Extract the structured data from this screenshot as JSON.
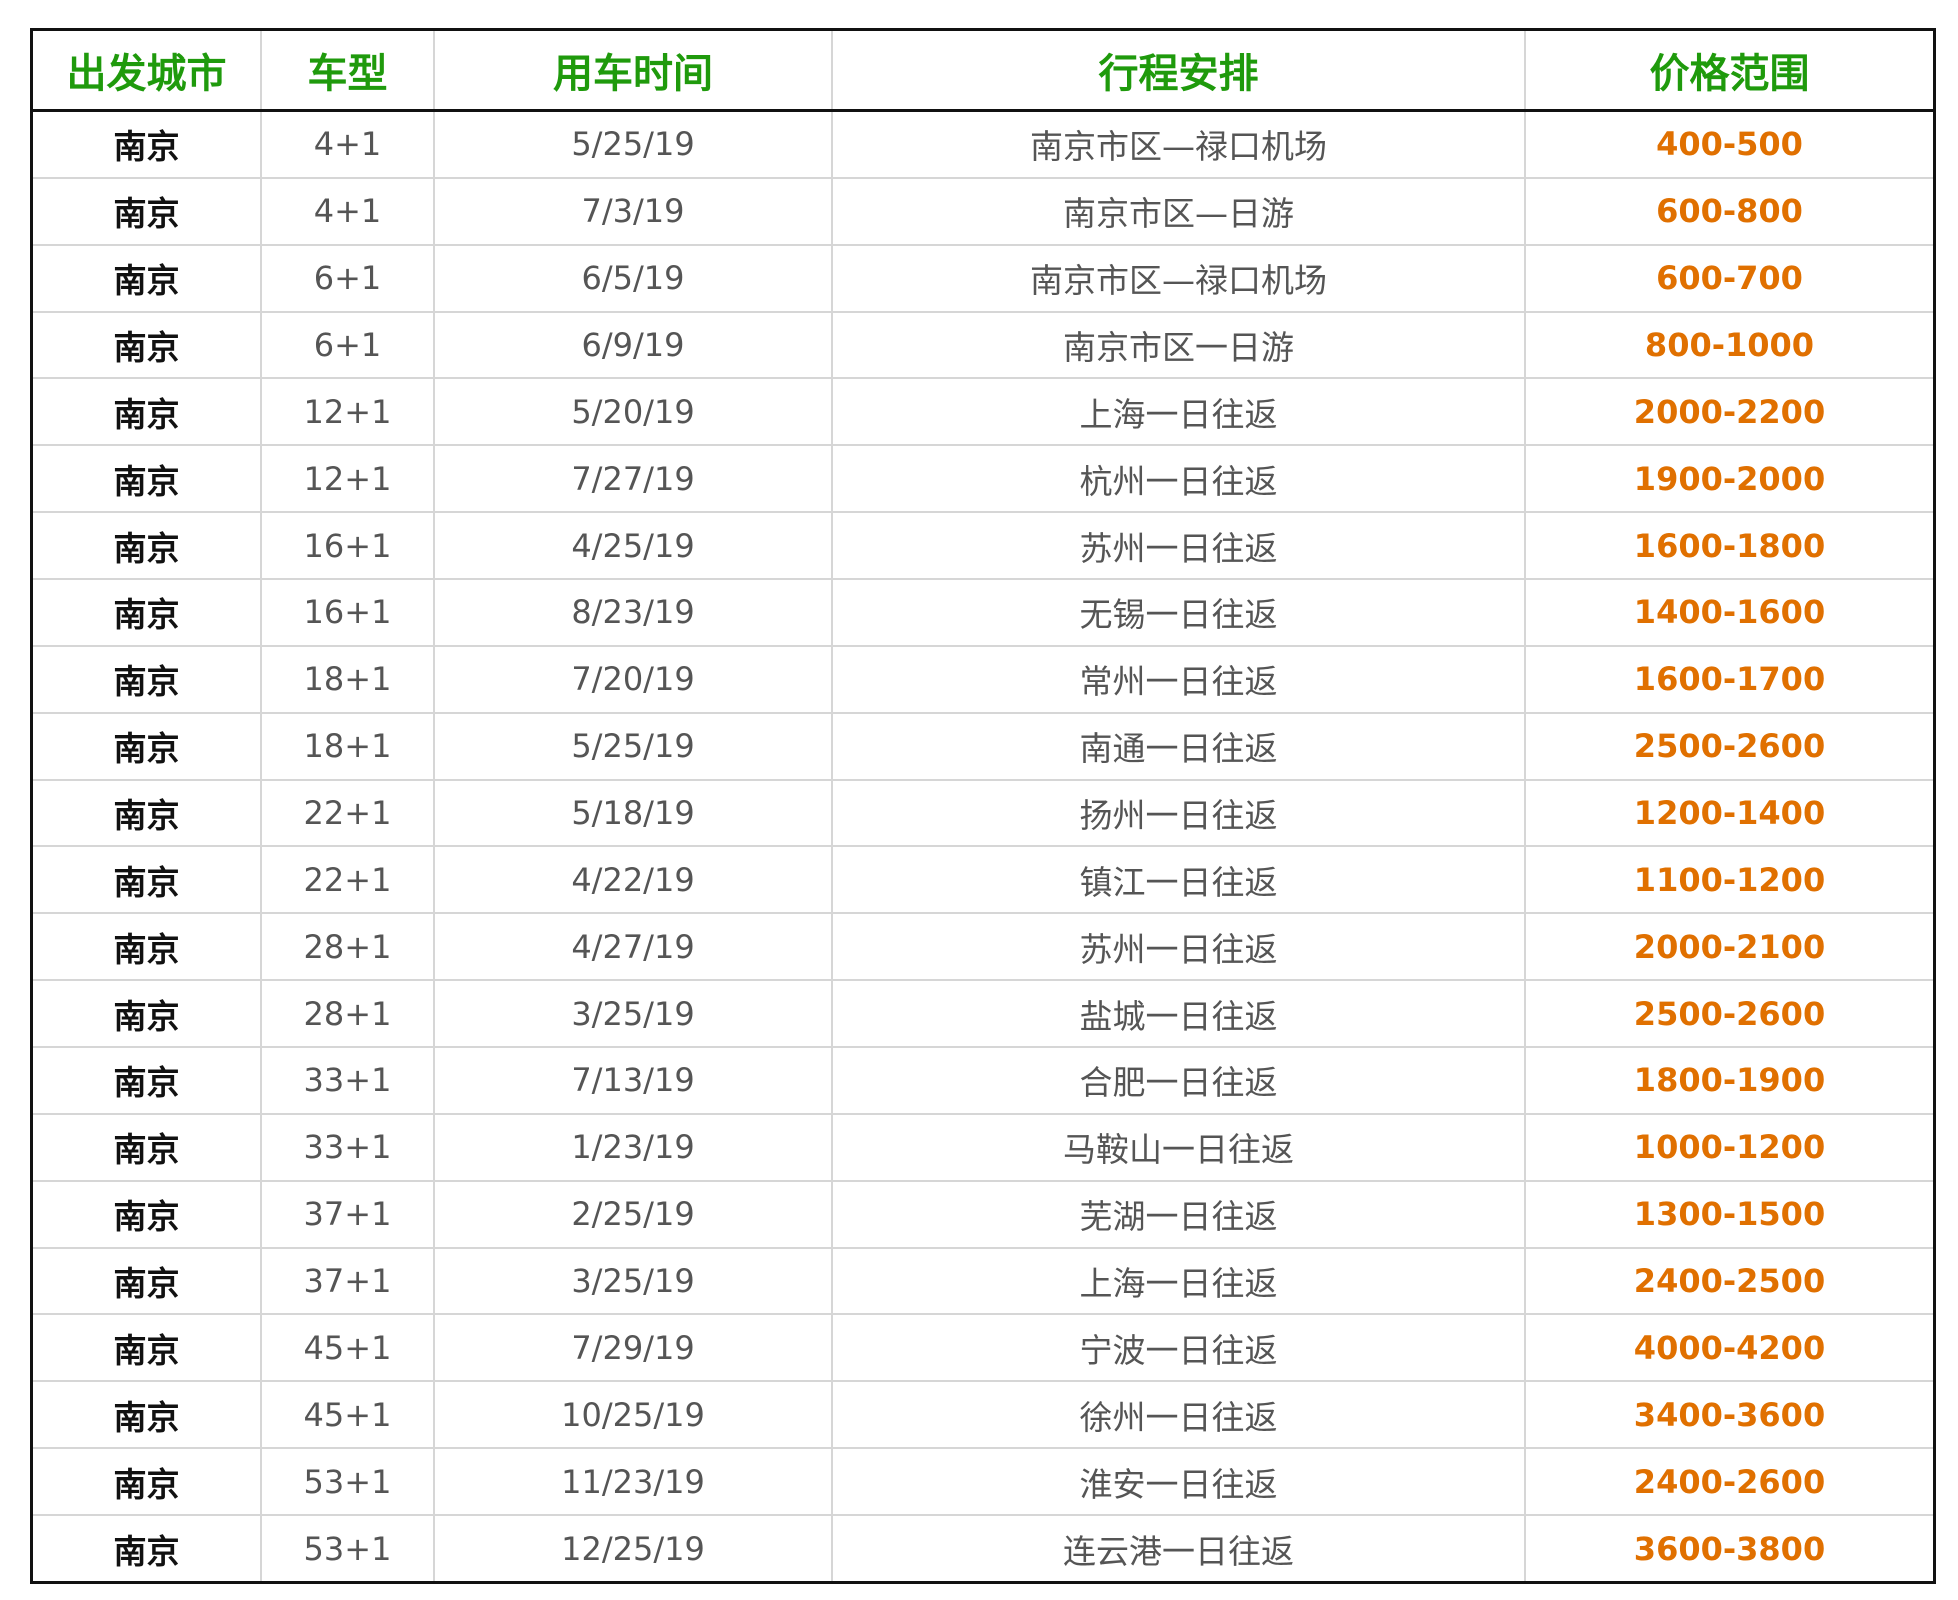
{
  "colors": {
    "header_text": "#1f9a0c",
    "price_text": "#e07000",
    "city_text": "#111111",
    "body_text": "#555555",
    "grid_line": "#d6d6d6",
    "outer_border": "#111111"
  },
  "table": {
    "headers": [
      "出发城市",
      "车型",
      "用车时间",
      "行程安排",
      "价格范围"
    ],
    "rows": [
      {
        "city": "南京",
        "vehicle": "4+1",
        "date": "5/25/19",
        "route": "南京市区—禄口机场",
        "price": "400-500"
      },
      {
        "city": "南京",
        "vehicle": "4+1",
        "date": "7/3/19",
        "route": "南京市区—日游",
        "price": "600-800"
      },
      {
        "city": "南京",
        "vehicle": "6+1",
        "date": "6/5/19",
        "route": "南京市区—禄口机场",
        "price": "600-700"
      },
      {
        "city": "南京",
        "vehicle": "6+1",
        "date": "6/9/19",
        "route": "南京市区一日游",
        "price": "800-1000"
      },
      {
        "city": "南京",
        "vehicle": "12+1",
        "date": "5/20/19",
        "route": "上海一日往返",
        "price": "2000-2200"
      },
      {
        "city": "南京",
        "vehicle": "12+1",
        "date": "7/27/19",
        "route": "杭州一日往返",
        "price": "1900-2000"
      },
      {
        "city": "南京",
        "vehicle": "16+1",
        "date": "4/25/19",
        "route": "苏州一日往返",
        "price": "1600-1800"
      },
      {
        "city": "南京",
        "vehicle": "16+1",
        "date": "8/23/19",
        "route": "无锡一日往返",
        "price": "1400-1600"
      },
      {
        "city": "南京",
        "vehicle": "18+1",
        "date": "7/20/19",
        "route": "常州一日往返",
        "price": "1600-1700"
      },
      {
        "city": "南京",
        "vehicle": "18+1",
        "date": "5/25/19",
        "route": "南通一日往返",
        "price": "2500-2600"
      },
      {
        "city": "南京",
        "vehicle": "22+1",
        "date": "5/18/19",
        "route": "扬州一日往返",
        "price": "1200-1400"
      },
      {
        "city": "南京",
        "vehicle": "22+1",
        "date": "4/22/19",
        "route": "镇江一日往返",
        "price": "1100-1200"
      },
      {
        "city": "南京",
        "vehicle": "28+1",
        "date": "4/27/19",
        "route": "苏州一日往返",
        "price": "2000-2100"
      },
      {
        "city": "南京",
        "vehicle": "28+1",
        "date": "3/25/19",
        "route": "盐城一日往返",
        "price": "2500-2600"
      },
      {
        "city": "南京",
        "vehicle": "33+1",
        "date": "7/13/19",
        "route": "合肥一日往返",
        "price": "1800-1900"
      },
      {
        "city": "南京",
        "vehicle": "33+1",
        "date": "1/23/19",
        "route": "马鞍山一日往返",
        "price": "1000-1200"
      },
      {
        "city": "南京",
        "vehicle": "37+1",
        "date": "2/25/19",
        "route": "芜湖一日往返",
        "price": "1300-1500"
      },
      {
        "city": "南京",
        "vehicle": "37+1",
        "date": "3/25/19",
        "route": "上海一日往返",
        "price": "2400-2500"
      },
      {
        "city": "南京",
        "vehicle": "45+1",
        "date": "7/29/19",
        "route": "宁波一日往返",
        "price": "4000-4200"
      },
      {
        "city": "南京",
        "vehicle": "45+1",
        "date": "10/25/19",
        "route": "徐州一日往返",
        "price": "3400-3600"
      },
      {
        "city": "南京",
        "vehicle": "53+1",
        "date": "11/23/19",
        "route": "淮安一日往返",
        "price": "2400-2600"
      },
      {
        "city": "南京",
        "vehicle": "53+1",
        "date": "12/25/19",
        "route": "连云港一日往返",
        "price": "3600-3800"
      }
    ]
  }
}
